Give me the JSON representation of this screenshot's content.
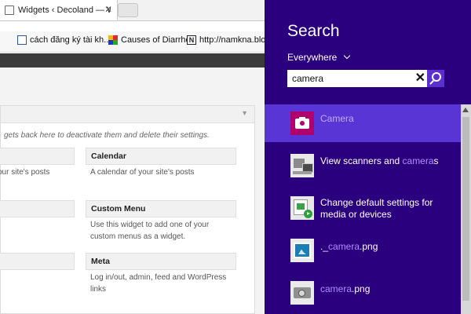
{
  "browser": {
    "tab_title": "Widgets ‹ Decoland — Wo",
    "tab_close": "✕",
    "bookmarks": [
      {
        "label": "cách đăng ký tài kh...",
        "icon": "document-icon"
      },
      {
        "label": "Causes of Diarrhea",
        "icon": "grid-icon"
      },
      {
        "label": "http://namkna.blog",
        "icon": "n-logo-icon",
        "glyph": "N"
      }
    ]
  },
  "widgets_page": {
    "panel_description": "gets back here to deactivate them and delete their settings.",
    "collapse_arrow": "▼",
    "widgets": [
      {
        "title": "Calendar",
        "description": "A calendar of your site's posts"
      },
      {
        "title": "Custom Menu",
        "description": "Use this widget to add one of your custom menus as a widget."
      },
      {
        "title": "Meta",
        "description": "Log in/out, admin, feed and WordPress links"
      }
    ],
    "left_column_fragments": [
      "our site's posts"
    ]
  },
  "search_charm": {
    "title": "Search",
    "scope": "Everywhere",
    "query": "camera",
    "clear_glyph": "✕",
    "results": [
      {
        "pre": "",
        "highlight": "Camera",
        "post": "",
        "icon": "camera-app-icon",
        "selected": true
      },
      {
        "pre": "View scanners and ",
        "highlight": "camera",
        "post": "s",
        "icon": "scanner-icon",
        "selected": false
      },
      {
        "pre": "Change default settings for media or devices",
        "highlight": "",
        "post": "",
        "icon": "media-devices-icon",
        "selected": false
      },
      {
        "pre": "._",
        "highlight": "camera",
        "post": ".png",
        "icon": "png-image-icon",
        "selected": false
      },
      {
        "pre": "",
        "highlight": "camera",
        "post": ".png",
        "icon": "png-camera-icon",
        "selected": false
      }
    ]
  },
  "colors": {
    "charm_background": "#2b007e",
    "selection": "#5a35d6",
    "highlight_text": "#b08cff"
  }
}
